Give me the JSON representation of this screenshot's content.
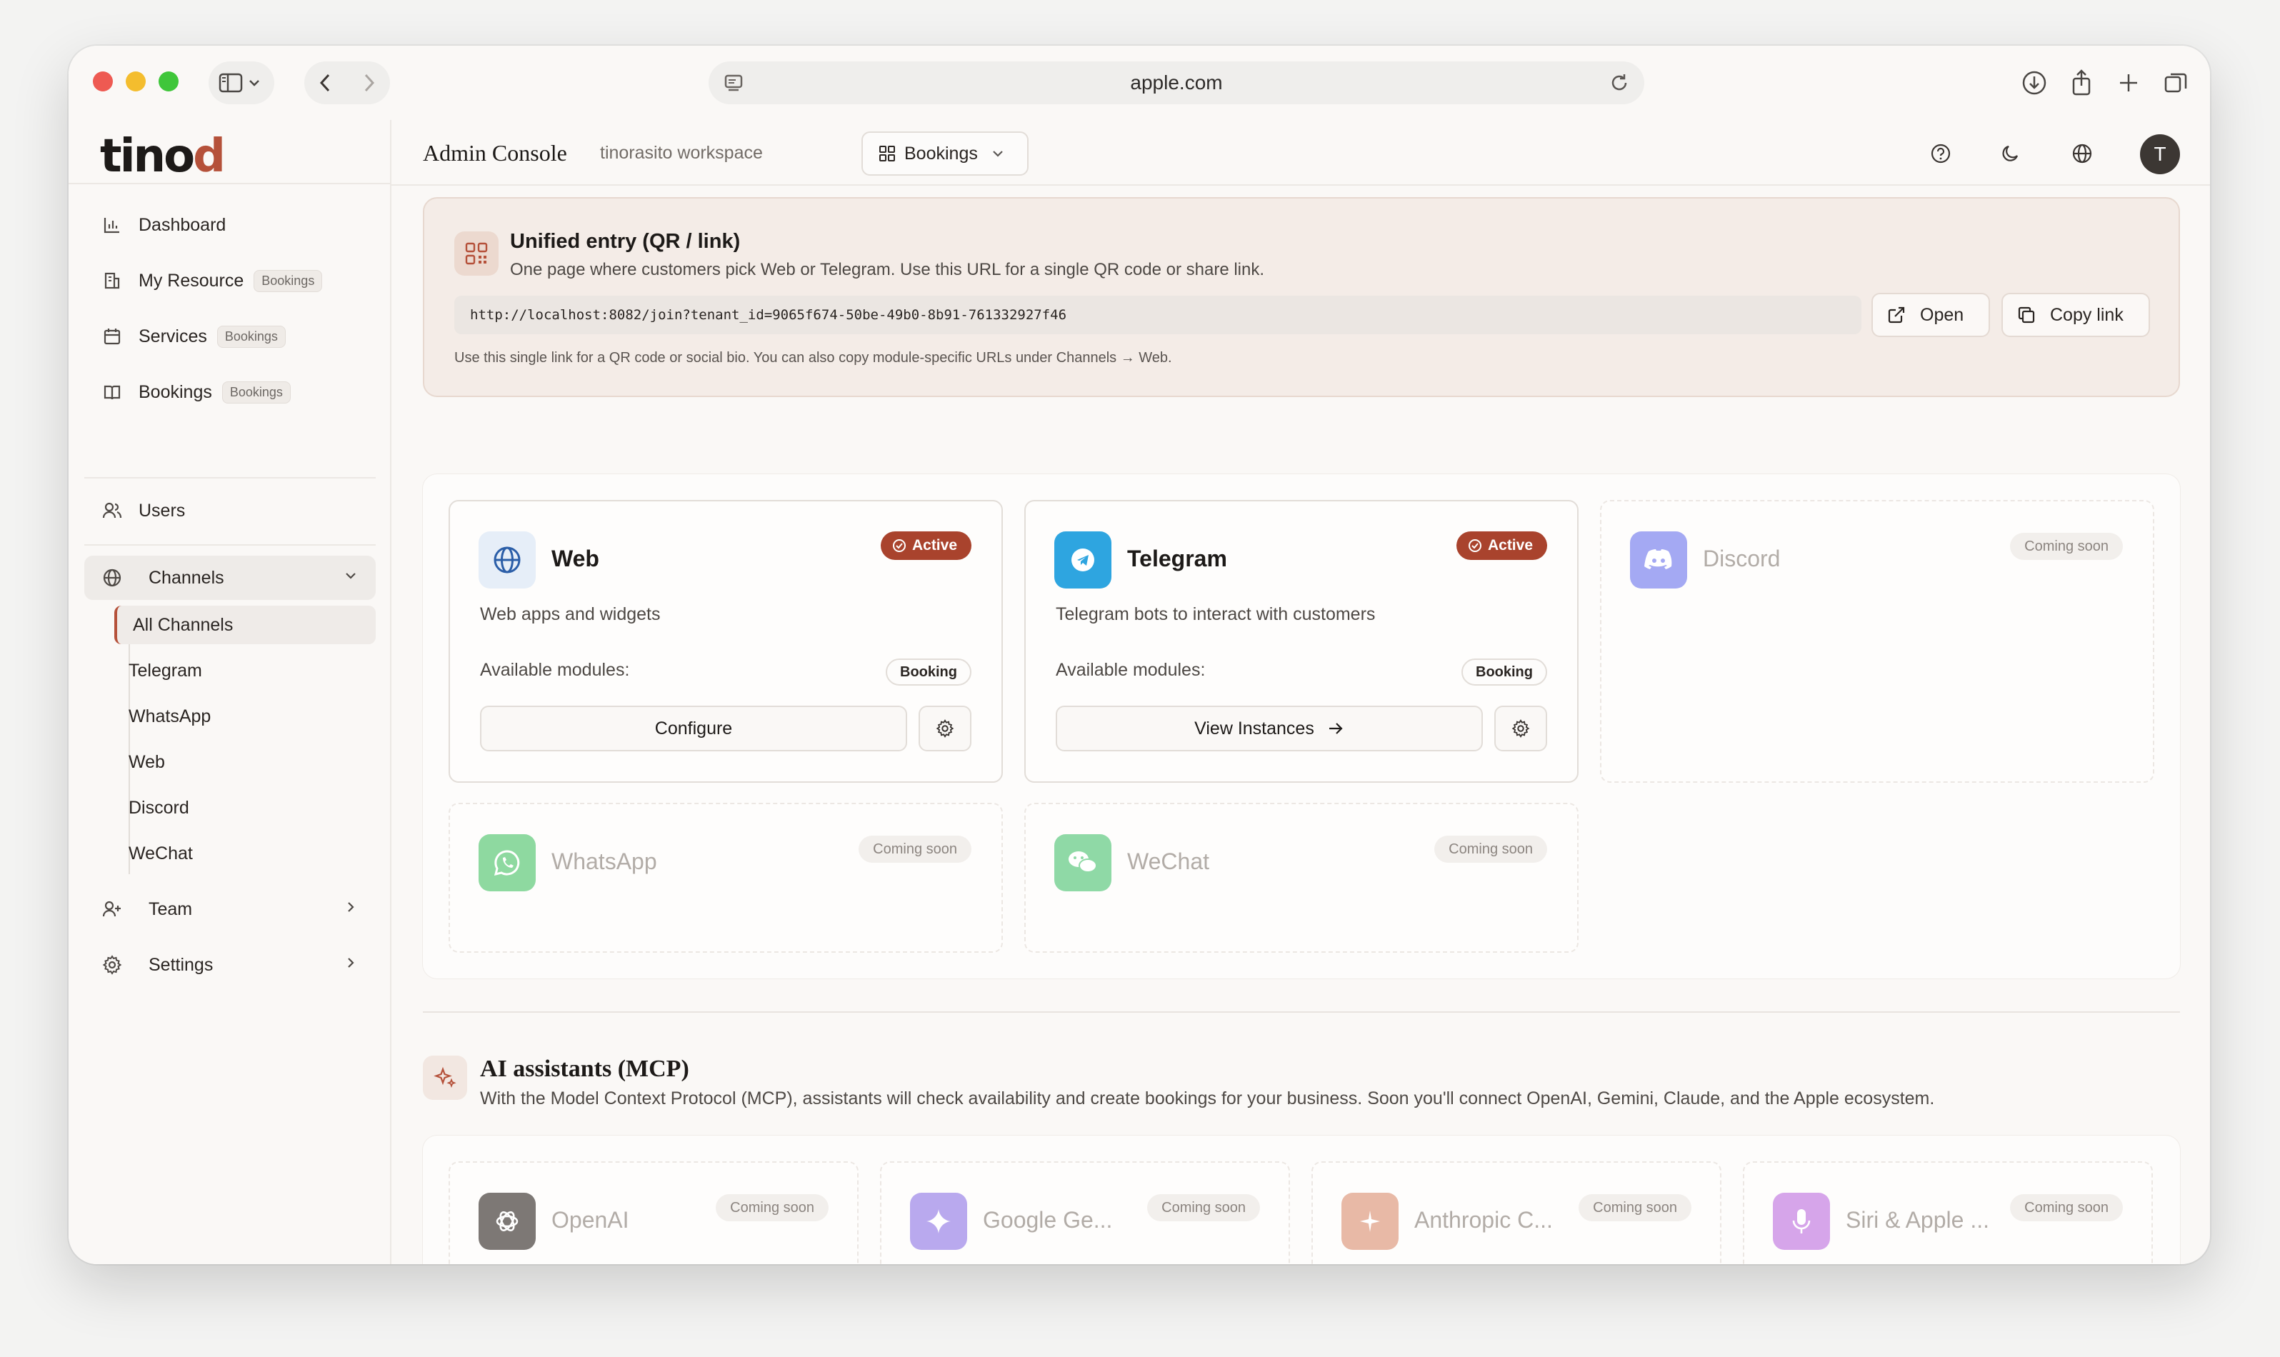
{
  "browser": {
    "url": "apple.com"
  },
  "brand": {
    "logo_main": "tino",
    "logo_accent": "d"
  },
  "sidebar": {
    "items": [
      {
        "label": "Dashboard",
        "badge": ""
      },
      {
        "label": "My Resource",
        "badge": "Bookings"
      },
      {
        "label": "Services",
        "badge": "Bookings"
      },
      {
        "label": "Bookings",
        "badge": "Bookings"
      },
      {
        "label": "Users",
        "badge": ""
      }
    ],
    "channels_label": "Channels",
    "channel_sub": [
      "All Channels",
      "Telegram",
      "WhatsApp",
      "Web",
      "Discord",
      "WeChat"
    ],
    "team_label": "Team",
    "settings_label": "Settings"
  },
  "header": {
    "title": "Admin Console",
    "workspace": "tinorasito workspace",
    "module": "Bookings",
    "avatar_initial": "T"
  },
  "unified": {
    "title": "Unified entry (QR / link)",
    "subtitle": "One page where customers pick Web or Telegram. Use this URL for a single QR code or share link.",
    "url": "http://localhost:8082/join?tenant_id=9065f674-50be-49b0-8b91-761332927f46",
    "open_label": "Open",
    "copy_label": "Copy link",
    "note": "Use this single link for a QR code or social bio. You can also copy module-specific URLs under Channels → Web."
  },
  "channels": [
    {
      "name": "Web",
      "status": "Active",
      "desc": "Web apps and widgets",
      "modules_label": "Available modules:",
      "module": "Booking",
      "action": "Configure",
      "color": "#e6eef8"
    },
    {
      "name": "Telegram",
      "status": "Active",
      "desc": "Telegram bots to interact with customers",
      "modules_label": "Available modules:",
      "module": "Booking",
      "action": "View Instances",
      "color": "#2ea5e0"
    },
    {
      "name": "Discord",
      "status": "Coming soon",
      "color": "#a4a9f3"
    },
    {
      "name": "WhatsApp",
      "status": "Coming soon",
      "color": "#8ed9a0"
    },
    {
      "name": "WeChat",
      "status": "Coming soon",
      "color": "#8fd9a6"
    }
  ],
  "ai": {
    "title": "AI assistants (MCP)",
    "subtitle": "With the Model Context Protocol (MCP), assistants will check availability and create bookings for your business. Soon you'll connect OpenAI, Gemini, Claude, and the Apple ecosystem.",
    "items": [
      {
        "name": "OpenAI",
        "status": "Coming soon",
        "color": "#7d7875"
      },
      {
        "name": "Google Ge...",
        "status": "Coming soon",
        "color": "#b9a9ee"
      },
      {
        "name": "Anthropic C...",
        "status": "Coming soon",
        "color": "#e8b9a6"
      },
      {
        "name": "Siri & Apple ...",
        "status": "Coming soon",
        "color": "#d6a5ea"
      }
    ]
  },
  "colors": {
    "accent": "#a9432d",
    "background": "#faf8f6"
  }
}
